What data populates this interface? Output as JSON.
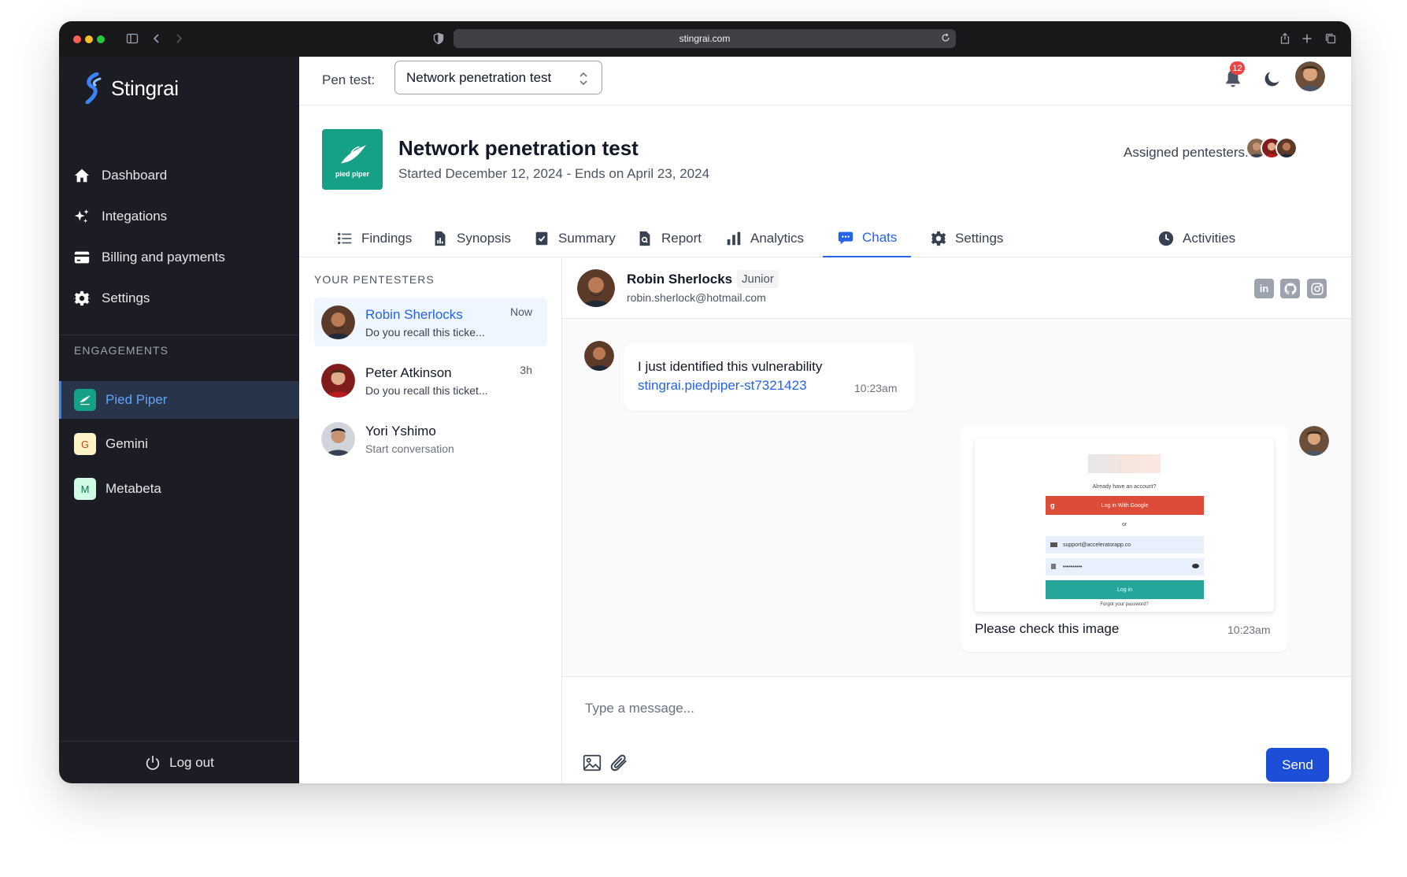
{
  "browser": {
    "url": "stingrai.com"
  },
  "app": {
    "name": "Stingrai"
  },
  "sidebar": {
    "nav": [
      {
        "label": "Dashboard",
        "icon": "home-icon"
      },
      {
        "label": "Integations",
        "icon": "sparkle-icon"
      },
      {
        "label": "Billing and payments",
        "icon": "credit-card-icon"
      },
      {
        "label": "Settings",
        "icon": "gear-icon"
      }
    ],
    "engagements_label": "ENGAGEMENTS",
    "engagements": [
      {
        "label": "Pied Piper",
        "badge": "",
        "active": true
      },
      {
        "label": "Gemini",
        "badge": "G",
        "active": false
      },
      {
        "label": "Metabeta",
        "badge": "M",
        "active": false
      }
    ],
    "logout_label": "Log out"
  },
  "topbar": {
    "pen_test_label": "Pen test:",
    "pen_test_value": "Network penetration test",
    "notification_count": "12"
  },
  "project": {
    "logo_text": "pied piper",
    "title": "Network penetration test",
    "dates": "Started December 12, 2024 - Ends on April 23, 2024",
    "assigned_label": "Assigned pentesters:"
  },
  "tabs": [
    {
      "label": "Findings",
      "icon": "list-icon"
    },
    {
      "label": "Synopsis",
      "icon": "document-chart-icon"
    },
    {
      "label": "Summary",
      "icon": "checklist-icon"
    },
    {
      "label": "Report",
      "icon": "document-search-icon"
    },
    {
      "label": "Analytics",
      "icon": "bar-chart-icon"
    },
    {
      "label": "Chats",
      "icon": "chat-bubble-icon",
      "active": true
    },
    {
      "label": "Settings",
      "icon": "gear-icon"
    },
    {
      "label": "Activities",
      "icon": "clock-icon"
    }
  ],
  "pentesters": {
    "title": "YOUR PENTESTERS",
    "items": [
      {
        "name": "Robin Sherlocks",
        "message": "Do you recall this ticke...",
        "time": "Now",
        "active": true
      },
      {
        "name": "Peter Atkinson",
        "message": "Do you recall this ticket...",
        "time": "3h",
        "active": false
      },
      {
        "name": "Yori Yshimo",
        "message": "Start conversation",
        "time": "",
        "active": false
      }
    ]
  },
  "chat": {
    "contact_name": "Robin Sherlocks",
    "contact_level": "Junior",
    "contact_email": "robin.sherlock@hotmail.com",
    "social": [
      "linkedin-icon",
      "github-icon",
      "instagram-icon"
    ],
    "messages": [
      {
        "text": "I just identified this vulnerability",
        "link": "stingrai.piedpiper-st7321423",
        "time": "10:23am"
      },
      {
        "text": "Please check this image",
        "time": "10:23am",
        "image": {
          "question": "Already have an account?",
          "google_button": "Log in With Google",
          "or": "or",
          "email": "support@acceleratorapp.co",
          "password": "••••••••••",
          "login_button": "Log in",
          "forgot": "Forgot your password?"
        }
      }
    ],
    "composer_placeholder": "Type a message...",
    "send_label": "Send"
  },
  "colors": {
    "accent": "#2563eb",
    "sidebar_bg": "#1c1c24",
    "brand_green": "#16a085"
  }
}
